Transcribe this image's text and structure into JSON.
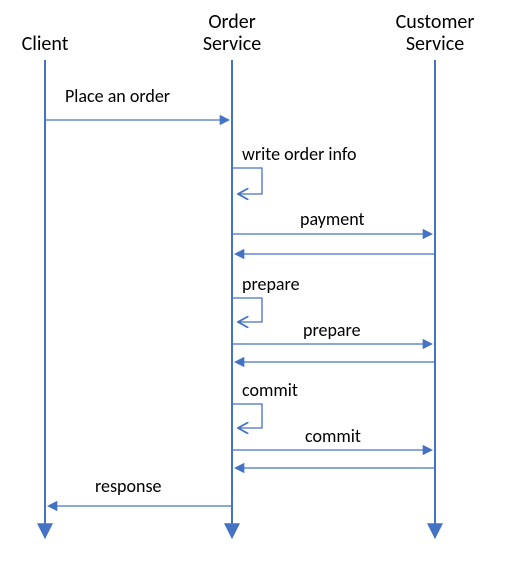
{
  "actors": {
    "client": "Client",
    "order_service_line1": "Order",
    "order_service_line2": "Service",
    "customer_service_line1": "Customer",
    "customer_service_line2": "Service"
  },
  "messages": {
    "place_order": "Place an order",
    "write_order_info": "write order info",
    "payment": "payment",
    "prepare_self": "prepare",
    "prepare_msg": "prepare",
    "commit_self": "commit",
    "commit_msg": "commit",
    "response": "response"
  },
  "colors": {
    "line": "#4472c4"
  }
}
